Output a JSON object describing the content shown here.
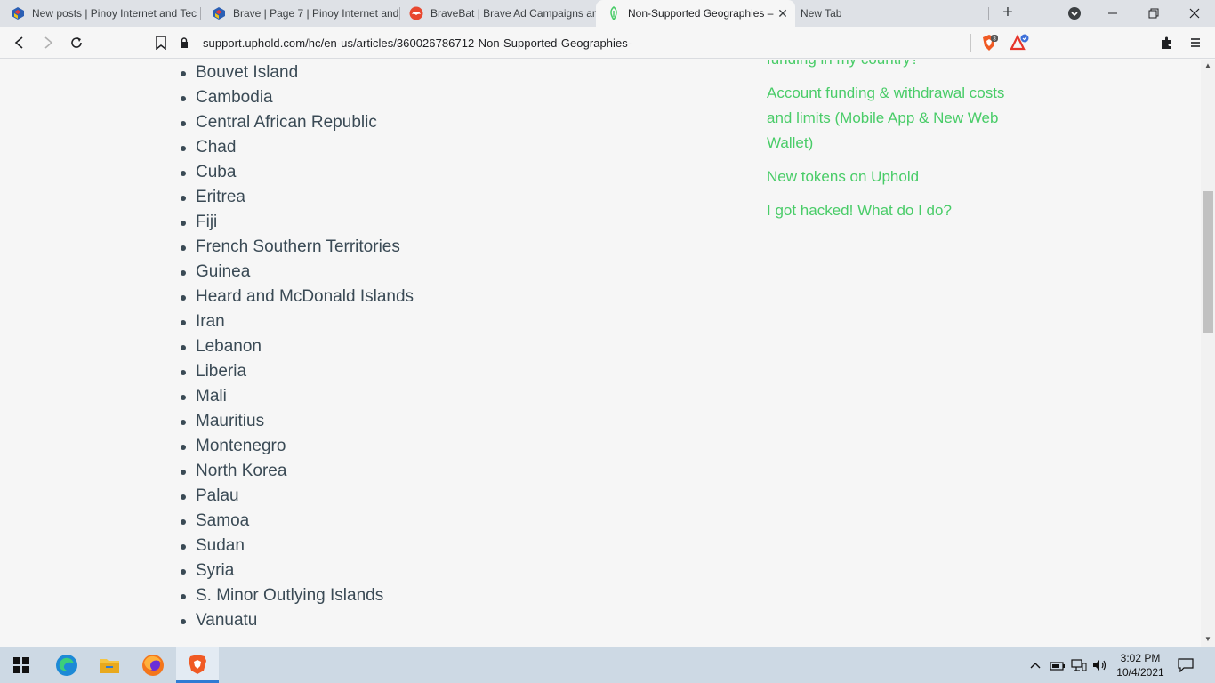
{
  "tabs": [
    {
      "title": "New posts | Pinoy Internet and Tec",
      "icon": "pinoy-favicon-icon",
      "active": false
    },
    {
      "title": "Brave | Page 7 | Pinoy Internet and",
      "icon": "pinoy-favicon-icon",
      "active": false
    },
    {
      "title": "BraveBat | Brave Ad Campaigns an",
      "icon": "bravebat-favicon-icon",
      "active": false
    },
    {
      "title": "Non-Supported Geographies –",
      "icon": "uphold-favicon-icon",
      "active": true
    },
    {
      "title": "New Tab",
      "icon": "",
      "active": false
    }
  ],
  "toolbar": {
    "url": "support.uphold.com/hc/en-us/articles/360026786712-Non-Supported-Geographies-",
    "shields_count": "3"
  },
  "countries": [
    "Bouvet Island",
    "Cambodia",
    "Central African Republic",
    "Chad",
    "Cuba",
    "Eritrea",
    "Fiji",
    "French Southern Territories",
    "Guinea",
    "Heard and McDonald Islands",
    "Iran",
    "Lebanon",
    "Liberia",
    "Mali",
    "Mauritius",
    "Montenegro",
    "North Korea",
    "Palau",
    "Samoa",
    "Sudan",
    "Syria",
    "S. Minor Outlying Islands",
    "Vanuatu"
  ],
  "related_articles": [
    "funding in my country?",
    "Account funding & withdrawal costs and limits (Mobile App & New Web Wallet)",
    "New tokens on Uphold",
    "I got hacked! What do I do?"
  ],
  "taskbar": {
    "time": "3:02 PM",
    "date": "10/4/2021"
  },
  "colors": {
    "link_green": "#49cc68",
    "body_text": "#3a4a55",
    "taskbar": "#cdd9e4"
  }
}
